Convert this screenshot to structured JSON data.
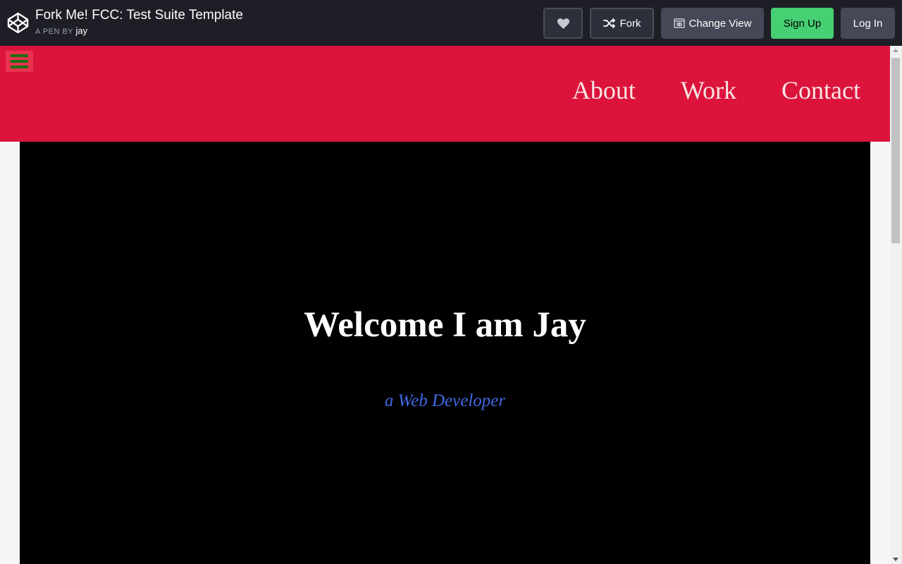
{
  "header": {
    "title": "Fork Me! FCC: Test Suite Template",
    "byline_prefix": "A PEN BY",
    "author": "jay",
    "buttons": {
      "heart_icon": "heart-icon",
      "fork": "Fork",
      "change_view": "Change View",
      "sign_up": "Sign Up",
      "log_in": "Log In"
    },
    "colors": {
      "bar": "#1e1f26",
      "sign_up": "#47cf73",
      "button": "#444857"
    }
  },
  "preview": {
    "nav": {
      "links": [
        "About",
        "Work",
        "Contact"
      ],
      "background": "#dc143c"
    },
    "welcome": {
      "title": "Welcome I am Jay",
      "subtitle": "a Web Developer",
      "background": "#000000",
      "subtitle_color": "#4169e1"
    }
  }
}
